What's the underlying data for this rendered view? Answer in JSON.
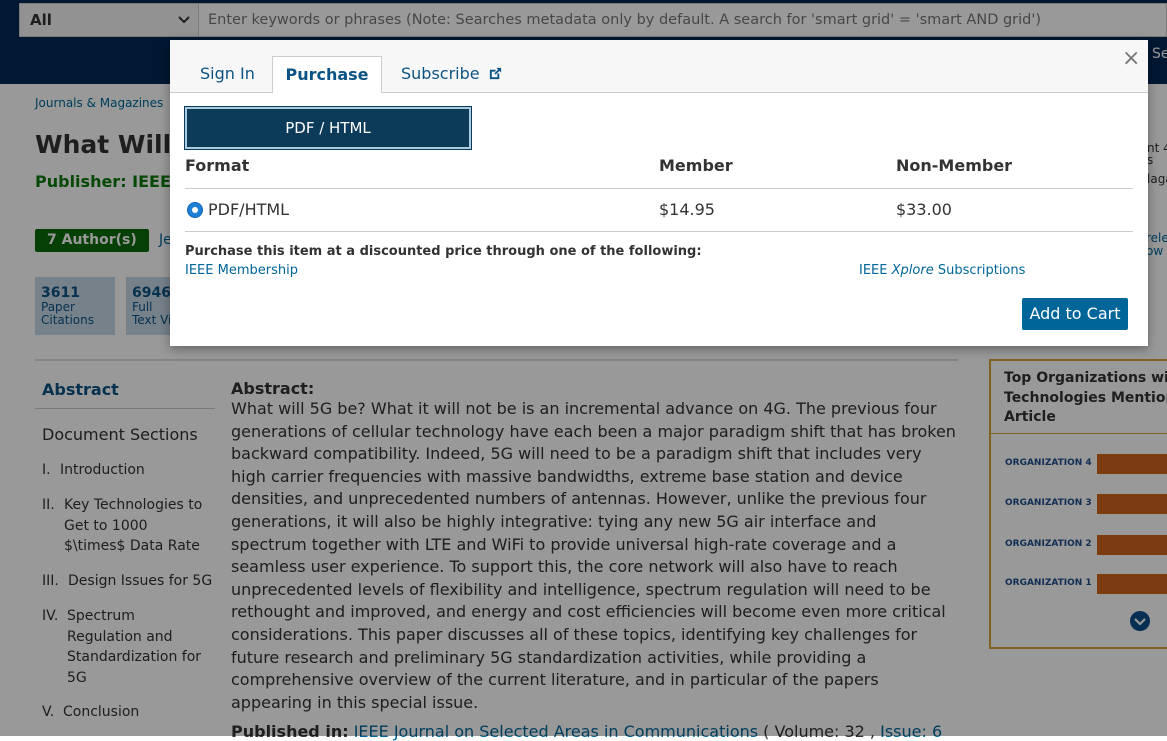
{
  "search": {
    "scope": "All",
    "placeholder": "Enter keywords or phrases (Note: Searches metadata only by default. A search for 'smart grid' = 'smart AND grid')",
    "top_right_text": "Se"
  },
  "page": {
    "breadcrumb": "Journals & Magazines",
    "title": "What Will",
    "publisher": "Publisher: IEEE",
    "authors_badge": "7 Author(s)",
    "author_link": "Je",
    "metrics": [
      {
        "value": "3611",
        "label_line1": "Paper",
        "label_line2": "Citations"
      },
      {
        "value": "6946",
        "label_line1": "Full",
        "label_line2": "Text Vi"
      }
    ],
    "sidebar": {
      "abstract": "Abstract",
      "sections_heading": "Document Sections",
      "items": [
        {
          "num": "I.",
          "label": "Introduction"
        },
        {
          "num": "II.",
          "label": "Key Technologies to Get to 1000 $\\times$ Data Rate"
        },
        {
          "num": "III.",
          "label": "Design Issues for 5G"
        },
        {
          "num": "IV.",
          "label": "Spectrum Regulation and Standardization for 5G"
        },
        {
          "num": "V.",
          "label": "Conclusion"
        }
      ]
    },
    "abstract_heading": "Abstract:",
    "abstract_text": "What will 5G be? What it will not be is an incremental advance on 4G. The previous four generations of cellular technology have each been a major paradigm shift that has broken backward compatibility. Indeed, 5G will need to be a paradigm shift that includes very high carrier frequencies with massive bandwidths, extreme base station and device densities, and unprecedented numbers of antennas. However, unlike the previous four generations, it will also be highly integrative: tying any new 5G air interface and spectrum together with LTE and WiFi to provide universal high-rate coverage and a seamless user experience. To support this, the core network will also have to reach unprecedented levels of flexibility and intelligence, spectrum regulation will need to be rethought and improved, and energy and cost efficiencies will become even more critical considerations. This paper discusses all of these topics, identifying key challenges for future research and preliminary 5G standardization activities, while providing a comprehensive overview of the current literature, and in particular of the papers appearing in this special issue.",
    "published_in_label": "Published in:",
    "published_in_journal": "IEEE Journal on Selected Areas in Communications",
    "published_in_volume": "( Volume: 32 ,",
    "published_in_issue": "Issue: 6",
    "right_snippets": {
      "line1": "nt 4",
      "line2": "s",
      "line3": "laga",
      "line4": "rele",
      "line5": "ow"
    },
    "org_panel": {
      "title_line1": "Top Organizations wit",
      "title_line2": "Technologies Mentione",
      "title_line3": "Article",
      "rows": [
        {
          "label": "ORGANIZATION 4"
        },
        {
          "label": "ORGANIZATION 3"
        },
        {
          "label": "ORGANIZATION 2"
        },
        {
          "label": "ORGANIZATION 1"
        }
      ]
    }
  },
  "modal": {
    "tabs": {
      "signin": "Sign In",
      "purchase": "Purchase",
      "subscribe": "Subscribe"
    },
    "close": "×",
    "format_button": "PDF / HTML",
    "table_headers": {
      "format": "Format",
      "member": "Member",
      "non_member": "Non-Member"
    },
    "row": {
      "format": "PDF/HTML",
      "member_price": "$14.95",
      "non_member_price": "$33.00"
    },
    "discount_note": "Purchase this item at a discounted price through one of the following:",
    "membership_link": "IEEE Membership",
    "subscriptions_prefix": "IEEE",
    "subscriptions_brand": "Xplore",
    "subscriptions_suffix": "Subscriptions",
    "add_to_cart": "Add to Cart"
  },
  "colors": {
    "nav_bg": "#002855",
    "link": "#006699",
    "primary_button": "#006699",
    "format_button": "#0b3b58",
    "publisher_green": "#0a7a0a",
    "org_bar": "#d0651a",
    "org_border": "#d4a33a"
  }
}
